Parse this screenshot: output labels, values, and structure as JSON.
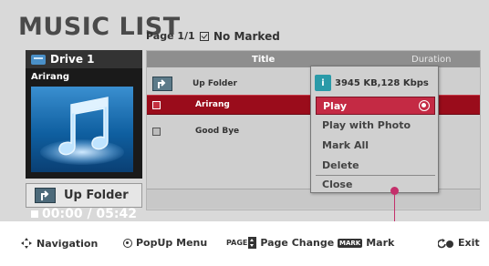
{
  "header": {
    "title": "MUSIC LIST",
    "page_info": "Page 1/1",
    "marked_label": "No Marked"
  },
  "left_panel": {
    "drive_label": "Drive 1",
    "current_song": "Arirang",
    "time": "00:00 / 05:42",
    "up_folder_button": "Up Folder"
  },
  "list": {
    "columns": [
      "Title",
      "Duration"
    ],
    "rows": [
      {
        "title": "Up Folder",
        "type": "folder"
      },
      {
        "title": "Arirang",
        "type": "file",
        "selected": true
      },
      {
        "title": "Good Bye",
        "type": "file"
      }
    ]
  },
  "popup": {
    "info": "3945 KB,128 Kbps",
    "items": [
      "Play",
      "Play with Photo",
      "Mark All",
      "Delete",
      "Close"
    ],
    "highlighted": "Play"
  },
  "bottom_bar": {
    "navigation": "Navigation",
    "popup_menu": "PopUp Menu",
    "page_key": "PAGE",
    "page_change": "Page Change",
    "mark_key": "MARK",
    "mark": "Mark",
    "exit": "Exit"
  },
  "colors": {
    "selected_row": "#9a0c1b",
    "popup_highlight": "#c42a44",
    "info_badge": "#2a9aa8",
    "pointer": "#c4306b"
  }
}
